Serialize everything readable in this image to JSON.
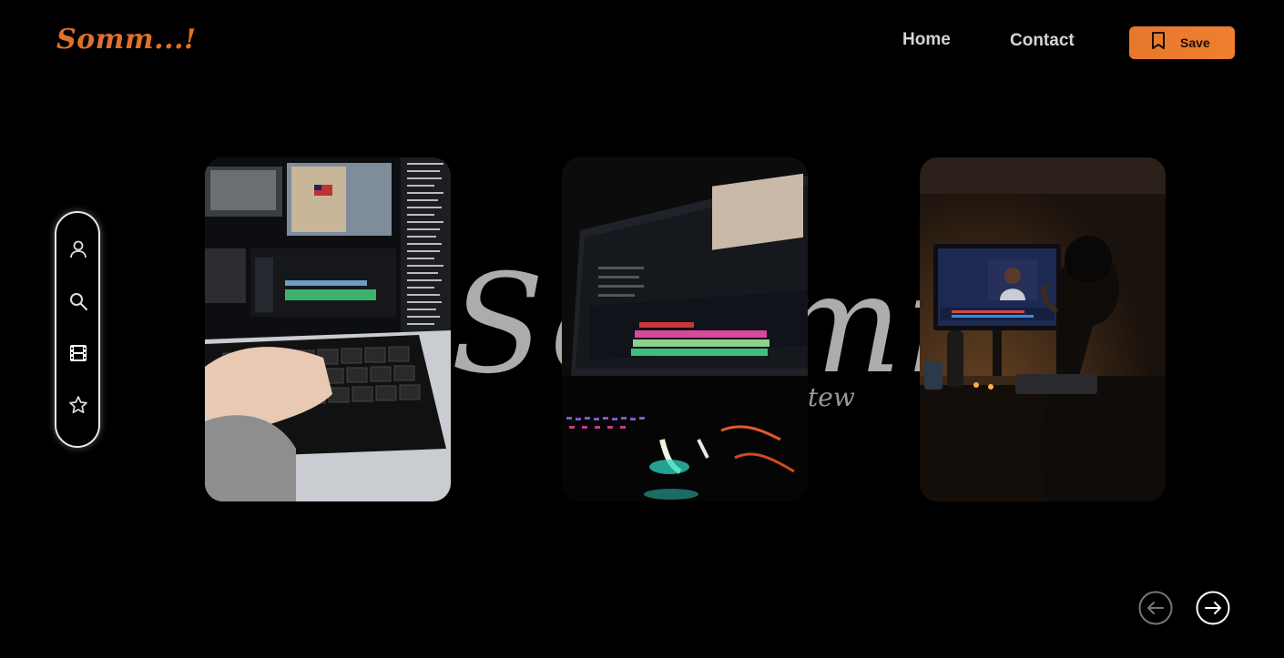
{
  "brand": {
    "logo": "Somm...!"
  },
  "nav": {
    "home": "Home",
    "contact": "Contact"
  },
  "save_button": {
    "label": "Save",
    "icon": "bookmark-icon",
    "color": "#ef7a2f"
  },
  "sidebar": {
    "items": [
      {
        "icon": "user-icon"
      },
      {
        "icon": "search-icon"
      },
      {
        "icon": "film-icon"
      },
      {
        "icon": "star-icon"
      }
    ]
  },
  "background_text": "Sommi!",
  "background_subtext": "tew",
  "gallery": {
    "cards": [
      {
        "image": "laptop-editing-software"
      },
      {
        "image": "monitor-timeline-editing"
      },
      {
        "image": "person-at-desk-monitor"
      }
    ]
  },
  "carousel": {
    "prev_icon": "arrow-left-icon",
    "next_icon": "arrow-right-icon"
  }
}
